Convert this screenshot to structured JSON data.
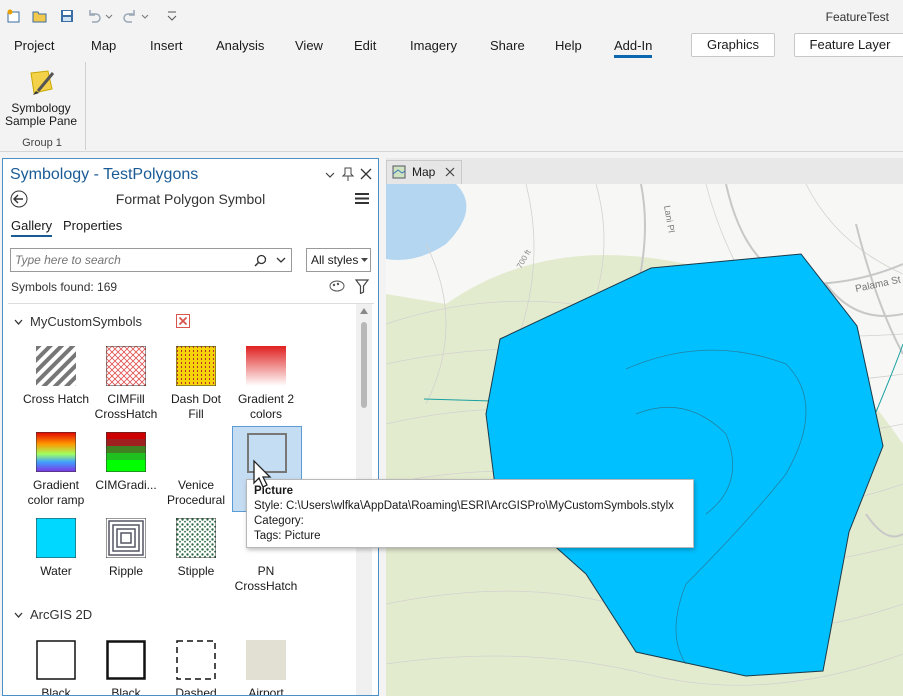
{
  "app": {
    "title": "FeatureTest"
  },
  "ribbon": {
    "tabs": [
      "Project",
      "Map",
      "Insert",
      "Analysis",
      "View",
      "Edit",
      "Imagery",
      "Share",
      "Help",
      "Add-In"
    ],
    "active_tab": "Add-In",
    "context_tabs": [
      "Graphics",
      "Feature Layer"
    ],
    "button_label_1": "Symbology",
    "button_label_2": "Sample Pane",
    "group_label": "Group 1"
  },
  "pane": {
    "title": "Symbology - TestPolygons",
    "subtitle": "Format Polygon Symbol",
    "tab_gallery": "Gallery",
    "tab_properties": "Properties",
    "search_placeholder": "Type here to search",
    "style_dropdown": "All styles",
    "symbols_found": "Symbols found: 169",
    "group1": "MyCustomSymbols",
    "group2": "ArcGIS 2D",
    "symbols": [
      {
        "l1": "Cross Hatch",
        "l2": ""
      },
      {
        "l1": "CIMFill",
        "l2": "CrossHatch"
      },
      {
        "l1": "Dash Dot",
        "l2": "Fill"
      },
      {
        "l1": "Gradient 2",
        "l2": "colors"
      },
      {
        "l1": "Gradient",
        "l2": "color ramp"
      },
      {
        "l1": "CIMGradi...",
        "l2": ""
      },
      {
        "l1": "Venice",
        "l2": "Procedural"
      },
      {
        "l1": "",
        "l2": ""
      },
      {
        "l1": "Water",
        "l2": ""
      },
      {
        "l1": "Ripple",
        "l2": ""
      },
      {
        "l1": "Stipple",
        "l2": ""
      },
      {
        "l1": "PN",
        "l2": "CrossHatch"
      },
      {
        "l1": "Black",
        "l2": ""
      },
      {
        "l1": "Black",
        "l2": ""
      },
      {
        "l1": "Dashed",
        "l2": ""
      },
      {
        "l1": "Airport",
        "l2": ""
      }
    ]
  },
  "map": {
    "tab_label": "Map",
    "labels": [
      "700 ft",
      "Palama St",
      "Lani Pl"
    ],
    "polygon_fill": "#00c0ff"
  },
  "tooltip": {
    "title": "Picture",
    "style": "Style: C:\\Users\\wlfka\\AppData\\Roaming\\ESRI\\ArcGISPro\\MyCustomSymbols.stylx",
    "category": "Category:",
    "tags": "Tags: Picture"
  }
}
